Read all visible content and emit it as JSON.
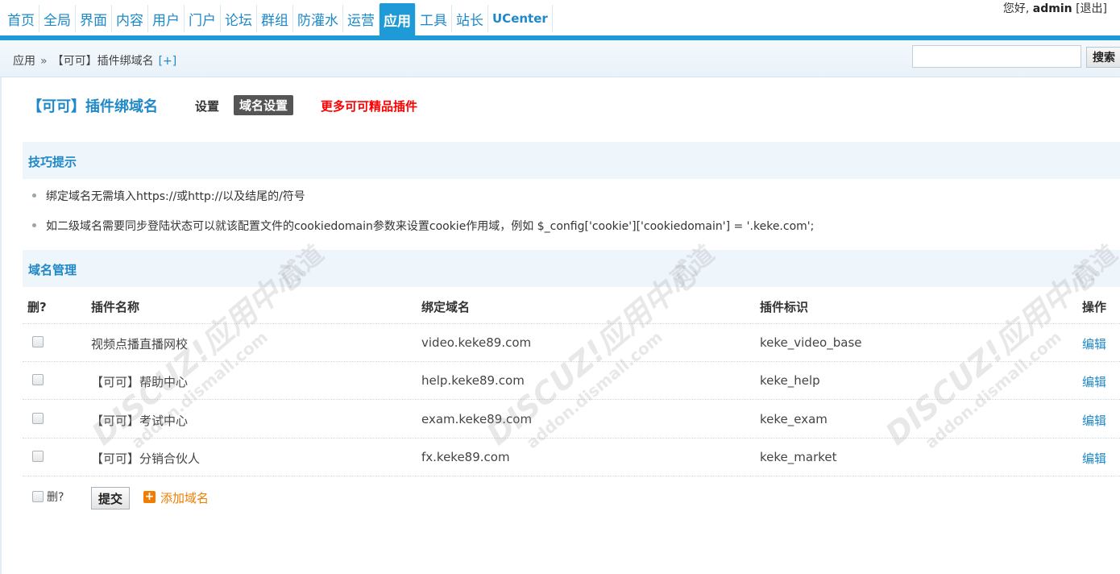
{
  "nav": {
    "items": [
      "首页",
      "全局",
      "界面",
      "内容",
      "用户",
      "门户",
      "论坛",
      "群组",
      "防灌水",
      "运营",
      "应用",
      "工具",
      "站长",
      "UCenter"
    ],
    "active_index": 10
  },
  "user": {
    "greeting": "您好,",
    "name": "admin",
    "logout": "[退出]"
  },
  "breadcrumb": {
    "root": "应用",
    "separator": "»",
    "current": "【可可】插件绑域名",
    "add": "[+]"
  },
  "search": {
    "value": "",
    "button": "搜索"
  },
  "plugin": {
    "title": "【可可】插件绑域名",
    "tab_settings": "设置",
    "tab_domain": "域名设置",
    "more_link": "更多可可精品插件"
  },
  "tips": {
    "heading": "技巧提示",
    "items": [
      "绑定域名无需填入https://或http://以及结尾的/符号",
      "如二级域名需要同步登陆状态可以就该配置文件的cookiedomain参数来设置cookie作用域，例如 $_config['cookie']['cookiedomain'] = '.keke.com';"
    ]
  },
  "domain_section": {
    "heading": "域名管理",
    "columns": [
      "删?",
      "插件名称",
      "绑定域名",
      "插件标识",
      "操作"
    ],
    "rows": [
      {
        "name": "视频点播直播网校",
        "domain": "video.keke89.com",
        "id": "keke_video_base",
        "action": "编辑"
      },
      {
        "name": "【可可】帮助中心",
        "domain": "help.keke89.com",
        "id": "keke_help",
        "action": "编辑"
      },
      {
        "name": "【可可】考试中心",
        "domain": "exam.keke89.com",
        "id": "keke_exam",
        "action": "编辑"
      },
      {
        "name": "【可可】分销合伙人",
        "domain": "fx.keke89.com",
        "id": "keke_market",
        "action": "编辑"
      }
    ]
  },
  "footer": {
    "delete_label": "删?",
    "submit": "提交",
    "add_domain": "添加域名"
  },
  "watermark": {
    "brand": "DISCUZ!应用中心",
    "url": "addon.dismall.com",
    "mark": "贰道"
  },
  "colors": {
    "nav_active": "#1e9bd7",
    "link": "#1e88c8",
    "alert": "#ff0000",
    "add": "#f07d00"
  }
}
